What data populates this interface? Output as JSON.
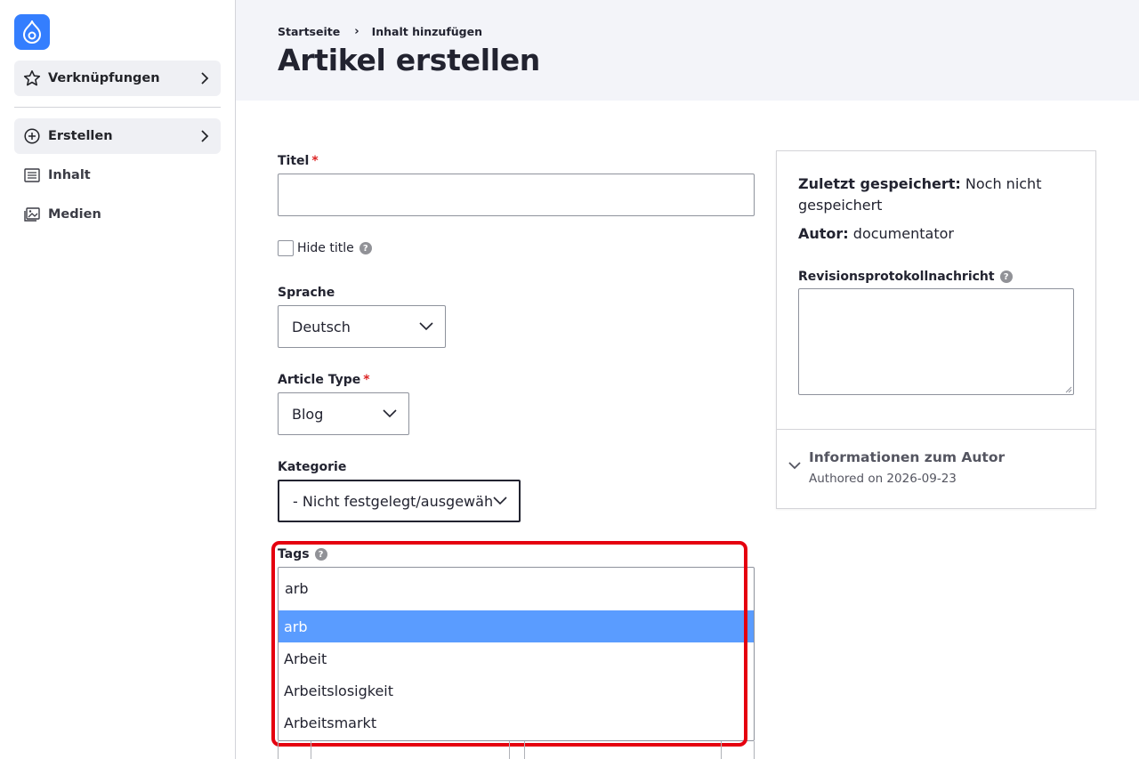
{
  "sidebar": {
    "items": [
      {
        "label": "Verknüpfungen",
        "icon": "star-icon"
      },
      {
        "label": "Erstellen",
        "icon": "plus-circle-icon"
      },
      {
        "label": "Inhalt",
        "icon": "content-list-icon"
      },
      {
        "label": "Medien",
        "icon": "media-image-icon"
      }
    ],
    "logo": "drupal-logo-icon"
  },
  "header": {
    "breadcrumb": [
      "Startseite",
      "Inhalt hinzufügen"
    ],
    "breadcrumb_separator": "›",
    "title": "Artikel erstellen"
  },
  "form": {
    "title": {
      "label": "Titel",
      "value": ""
    },
    "hide_title": {
      "label": "Hide title",
      "checked": false
    },
    "language": {
      "label": "Sprache",
      "value": "Deutsch"
    },
    "article_type": {
      "label": "Article Type",
      "value": "Blog"
    },
    "category": {
      "label": "Kategorie",
      "value": "- Nicht festgelegt/ausgewählt -"
    },
    "tags": {
      "label": "Tags",
      "value": "arb",
      "suggestions": [
        "arb",
        "Arbeit",
        "Arbeitslosigkeit",
        "Arbeitsmarkt"
      ],
      "active_index": 0
    },
    "required_marker": "*",
    "help_glyph": "?"
  },
  "panel": {
    "last_saved_label": "Zuletzt gespeichert:",
    "last_saved_value": "Noch nicht gespeichert",
    "author_label": "Autor:",
    "author_value": "documentator",
    "revision_label": "Revisionsprotokollnachricht",
    "revision_value": "",
    "author_info_title": "Informationen zum Autor",
    "author_info_sub": "Authored on 2026-09-23"
  },
  "colors": {
    "accent": "#347efe",
    "active_option": "#5a9cff",
    "highlight": "#e5000f",
    "required": "#dc2323"
  }
}
